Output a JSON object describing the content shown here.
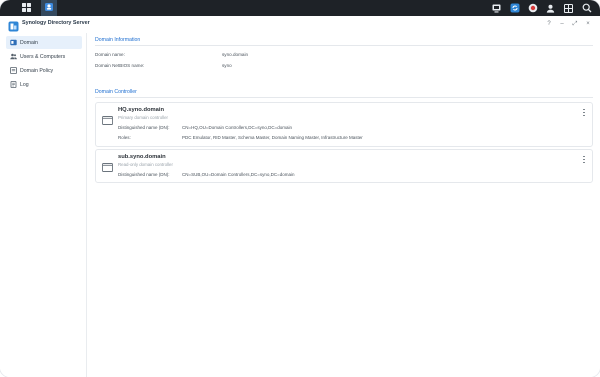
{
  "window": {
    "title": "Synology Directory Server"
  },
  "taskbar": {
    "left_icons": [
      "grid-icon",
      "directory-server-app-icon"
    ],
    "right_icons": [
      "monitor-icon",
      "sync-icon",
      "notification-icon",
      "user-icon",
      "widgets-icon",
      "search-icon"
    ]
  },
  "window_controls": [
    "?",
    "–",
    "⤢",
    "×"
  ],
  "sidebar": {
    "items": [
      {
        "label": "Domain",
        "icon": "domain-icon",
        "active": true
      },
      {
        "label": "Users & Computers",
        "icon": "users-icon",
        "active": false
      },
      {
        "label": "Domain Policy",
        "icon": "policy-icon",
        "active": false
      },
      {
        "label": "Log",
        "icon": "log-icon",
        "active": false
      }
    ]
  },
  "domain_info": {
    "title": "Domain Information",
    "rows": [
      {
        "key": "Domain name:",
        "value": "syno.domain"
      },
      {
        "key": "Domain NetBIOS name:",
        "value": "syno"
      }
    ]
  },
  "domain_controller": {
    "title": "Domain Controller",
    "cards": [
      {
        "name": "HQ.syno.domain",
        "subtitle": "Primary domain controller",
        "rows": [
          {
            "key": "Distinguished name (DN):",
            "value": "CN=HQ,OU=Domain Controllers,DC=syno,DC=domain"
          },
          {
            "key": "Roles:",
            "value": "PDC Emulator, RID Master, Schema Master, Domain Naming Master, Infrastructure Master"
          }
        ]
      },
      {
        "name": "sub.syno.domain",
        "subtitle": "Read-only domain controller",
        "rows": [
          {
            "key": "Distinguished name (DN):",
            "value": "CN=SUB,OU=Domain Controllers,DC=syno,DC=domain"
          }
        ]
      }
    ]
  },
  "colors": {
    "accent": "#1f6fd1",
    "taskbar": "#1e2227",
    "active_bg": "#e6f0fb"
  }
}
